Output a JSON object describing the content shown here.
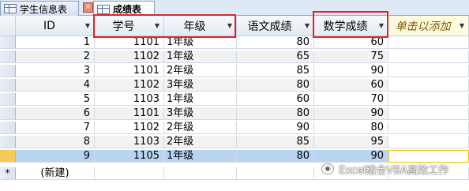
{
  "tabs": [
    {
      "label": "学生信息表"
    },
    {
      "label": "成绩表"
    }
  ],
  "close_glyph": "×",
  "columns": {
    "id": "ID",
    "student_no": "学号",
    "grade": "年级",
    "chinese": "语文成绩",
    "math": "数学成绩",
    "add": "单击以添加"
  },
  "dropdown_glyph": "▼",
  "rows": [
    {
      "id": "1",
      "student_no": "1101",
      "grade": "1年级",
      "chinese": "80",
      "math": "60"
    },
    {
      "id": "2",
      "student_no": "1102",
      "grade": "1年级",
      "chinese": "65",
      "math": "75"
    },
    {
      "id": "3",
      "student_no": "1101",
      "grade": "2年级",
      "chinese": "85",
      "math": "90"
    },
    {
      "id": "4",
      "student_no": "1102",
      "grade": "3年级",
      "chinese": "80",
      "math": "60"
    },
    {
      "id": "5",
      "student_no": "1103",
      "grade": "1年级",
      "chinese": "60",
      "math": "70"
    },
    {
      "id": "6",
      "student_no": "1101",
      "grade": "3年级",
      "chinese": "80",
      "math": "90"
    },
    {
      "id": "7",
      "student_no": "1102",
      "grade": "2年级",
      "chinese": "90",
      "math": "80"
    },
    {
      "id": "8",
      "student_no": "1103",
      "grade": "2年级",
      "chinese": "85",
      "math": "95"
    },
    {
      "id": "9",
      "student_no": "1105",
      "grade": "1年级",
      "chinese": "80",
      "math": "90"
    }
  ],
  "selected_row": 9,
  "new_row": {
    "marker": "*",
    "label": "(新建)"
  },
  "watermark": "Excel结合VBA高效工作",
  "colors": {
    "annotation": "#e2232a",
    "selected_row": "#b9d4f1",
    "record_selector": "#f6c95a"
  }
}
